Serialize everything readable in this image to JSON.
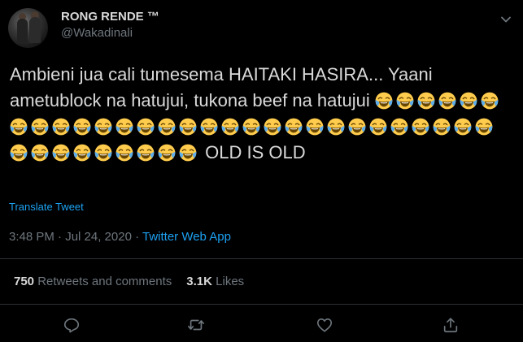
{
  "user": {
    "display_name": "RONG RENDE ™",
    "handle": "@Wakadinali"
  },
  "tweet": {
    "text_before": "Ambieni  jua cali tumesema HAITAKI HASIRA... Yaani ametublock na hatujui, tukona beef na hatujui",
    "emoji_count": 38,
    "text_after": "OLD IS OLD"
  },
  "translate_label": "Translate Tweet",
  "meta": {
    "time": "3:48 PM · Jul 24, 2020 · ",
    "source": "Twitter Web App"
  },
  "stats": {
    "retweets_count": "750",
    "retweets_label": "Retweets and comments",
    "likes_count": "3.1K",
    "likes_label": "Likes"
  },
  "actions": [
    "reply-icon",
    "retweet-icon",
    "like-icon",
    "share-icon"
  ],
  "colors": {
    "background": "#000000",
    "text": "#d9d9d9",
    "muted": "#6e767d",
    "accent": "#1da1f2",
    "divider": "#2f3336",
    "emoji_face": "#ffcc4d",
    "emoji_tear": "#5dadec"
  }
}
